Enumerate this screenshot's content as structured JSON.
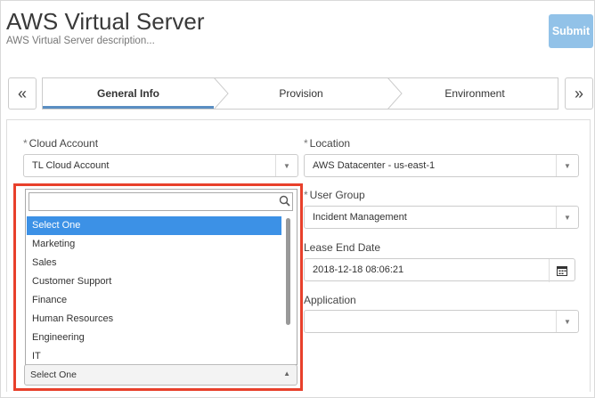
{
  "header": {
    "title": "AWS Virtual Server",
    "description": "AWS Virtual Server description...",
    "submit_label": "Submit"
  },
  "wizard": {
    "prev_icon": "«",
    "next_icon": "»",
    "steps": [
      {
        "label": "General Info",
        "active": true
      },
      {
        "label": "Provision",
        "active": false
      },
      {
        "label": "Environment",
        "active": false
      }
    ]
  },
  "form": {
    "required_mark": "*",
    "cloud_account": {
      "label": "Cloud Account",
      "value": "TL Cloud Account"
    },
    "location": {
      "label": "Location",
      "value": "AWS Datacenter - us-east-1"
    },
    "user_group": {
      "label": "User Group",
      "value": "Incident Management"
    },
    "lease_end_date": {
      "label": "Lease End Date",
      "value": "2018-12-18 08:06:21"
    },
    "application": {
      "label": "Application",
      "value": ""
    }
  },
  "dropdown": {
    "search_value": "",
    "items": [
      "Select One",
      "Marketing",
      "Sales",
      "Customer Support",
      "Finance",
      "Human Resources",
      "Engineering",
      "IT"
    ],
    "selected_index": 0,
    "current_value": "Select One"
  },
  "colors": {
    "highlight": "#e8402b",
    "selected": "#3c91e6",
    "submit": "#92c2e8",
    "active_step": "#5a8ec2"
  }
}
